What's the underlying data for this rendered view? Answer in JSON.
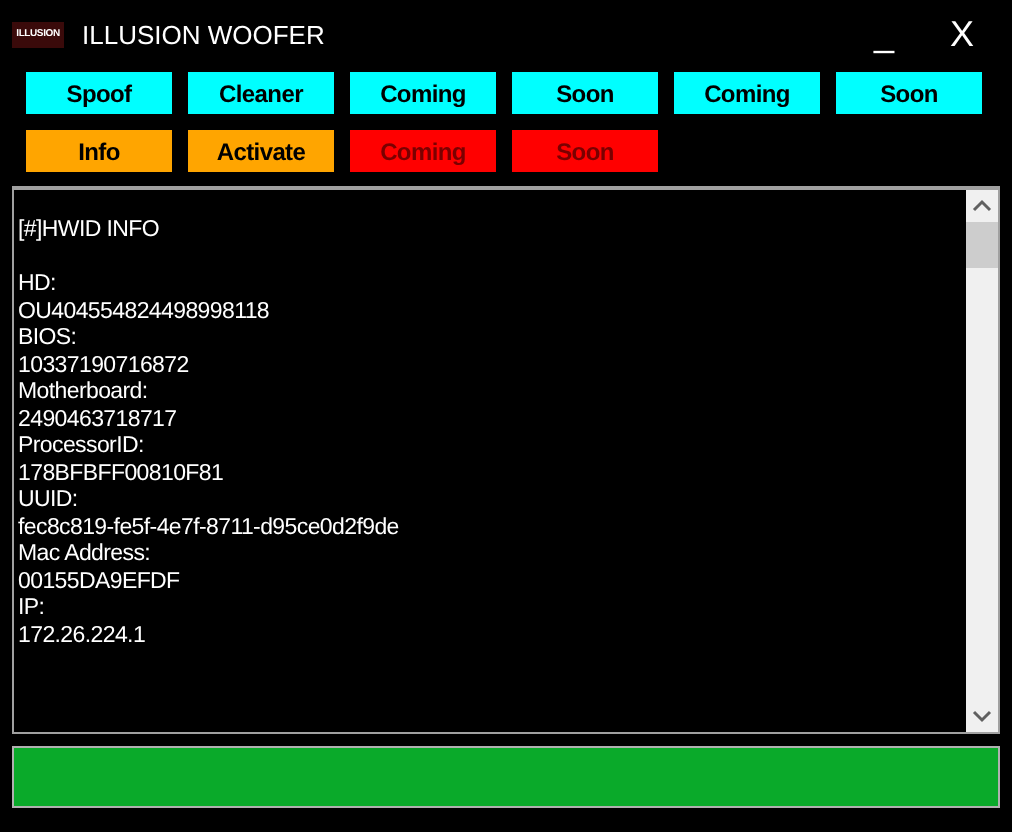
{
  "window": {
    "logo": "ILLUSION",
    "title": "ILLUSION WOOFER",
    "controls": [
      "_",
      "X"
    ]
  },
  "button_rows": [
    [
      {
        "label": "Spoof",
        "color": "#00ffff",
        "disabled": false
      },
      {
        "label": "Cleaner",
        "color": "#00ffff",
        "disabled": false
      },
      {
        "label": "Coming",
        "color": "#00ffff",
        "disabled": false
      },
      {
        "label": "Soon",
        "color": "#00ffff",
        "disabled": false
      },
      {
        "label": "Coming",
        "color": "#00ffff",
        "disabled": false
      },
      {
        "label": "Soon",
        "color": "#00ffff",
        "disabled": false
      }
    ],
    [
      {
        "label": "Info",
        "color": "#ffa500",
        "disabled": false
      },
      {
        "label": "Activate",
        "color": "#ffa500",
        "disabled": false
      },
      {
        "label": "Coming",
        "color": "#ff0000",
        "disabled": true
      },
      {
        "label": "Soon",
        "color": "#ff0000",
        "disabled": true
      }
    ]
  ],
  "output": {
    "header": "[#]HWID INFO",
    "lines": [
      "HD:",
      "OU404554824498998118",
      "BIOS:",
      "10337190716872",
      "Motherboard:",
      "2490463718717",
      "ProcessorID:",
      "178BFBFF00810F81",
      "UUID:",
      "fec8c819-fe5f-4e7f-8711-d95ce0d2f9de",
      "Mac Address:",
      "00155DA9EFDF",
      "IP:",
      "172.26.224.1"
    ]
  },
  "progress": {
    "level": 1
  }
}
